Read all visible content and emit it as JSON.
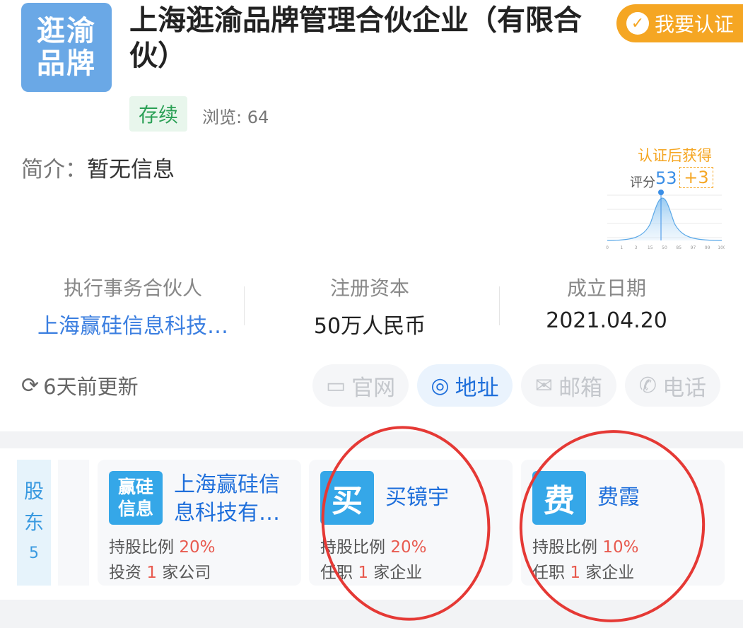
{
  "company": {
    "logo_line1": "逛渝",
    "logo_line2": "品牌",
    "name": "上海逛渝品牌管理合伙企业（有限合伙）",
    "certify_label": "我要认证",
    "status": "存续",
    "views_label": "浏览: 64"
  },
  "intro": {
    "key": "简介：",
    "value": "暂无信息"
  },
  "score": {
    "gain_label": "认证后获得",
    "score_label": "评分",
    "score_value": "53",
    "plus_value": "+3",
    "ticks": [
      "0",
      "1",
      "3",
      "15",
      "50",
      "85",
      "97",
      "99",
      "100"
    ]
  },
  "info": [
    {
      "label": "执行事务合伙人",
      "value": "上海赢硅信息科技…"
    },
    {
      "label": "注册资本",
      "value": "50万人民币"
    },
    {
      "label": "成立日期",
      "value": "2021.04.20"
    }
  ],
  "updated": "6天前更新",
  "contacts": [
    {
      "label": "官网",
      "icon": "monitor-icon"
    },
    {
      "label": "地址",
      "icon": "location-pin-icon"
    },
    {
      "label": "邮箱",
      "icon": "mail-icon"
    },
    {
      "label": "电话",
      "icon": "phone-icon"
    }
  ],
  "shareholders": {
    "label_1": "股",
    "label_2": "东",
    "count": "5",
    "items": [
      {
        "avatar_1": "赢硅",
        "avatar_2": "信息",
        "name_1": "上海赢硅信",
        "name_2": "息科技有…",
        "ratio_label": "持股比例",
        "ratio": "20%",
        "row2_a": "投资",
        "row2_num": "1",
        "row2_b": "家公司"
      },
      {
        "avatar": "买",
        "name": "买镜宇",
        "ratio_label": "持股比例",
        "ratio": "20%",
        "row2_a": "任职",
        "row2_num": "1",
        "row2_b": "家企业"
      },
      {
        "avatar": "费",
        "name": "费霞",
        "ratio_label": "持股比例",
        "ratio": "10%",
        "row2_a": "任职",
        "row2_num": "1",
        "row2_b": "家企业"
      }
    ]
  },
  "colors": {
    "accent": "#1f6fdb",
    "cert": "#f5a623",
    "status_green": "#2aa055",
    "highlight_red": "#e53935"
  }
}
